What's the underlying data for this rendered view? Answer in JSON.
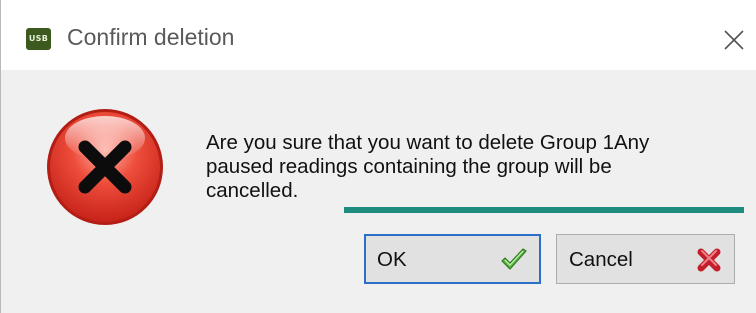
{
  "window": {
    "app_icon_text": "USB",
    "title": "Confirm deletion",
    "close_icon": "close-icon"
  },
  "dialog": {
    "icon": "error-icon",
    "message": "Are you sure that you want to delete Group 1Any paused readings containing the group will be cancelled.",
    "accent_color": "#1e8c7e"
  },
  "buttons": {
    "ok_label": "OK",
    "ok_icon": "checkmark-icon",
    "cancel_label": "Cancel",
    "cancel_icon": "red-x-icon"
  }
}
